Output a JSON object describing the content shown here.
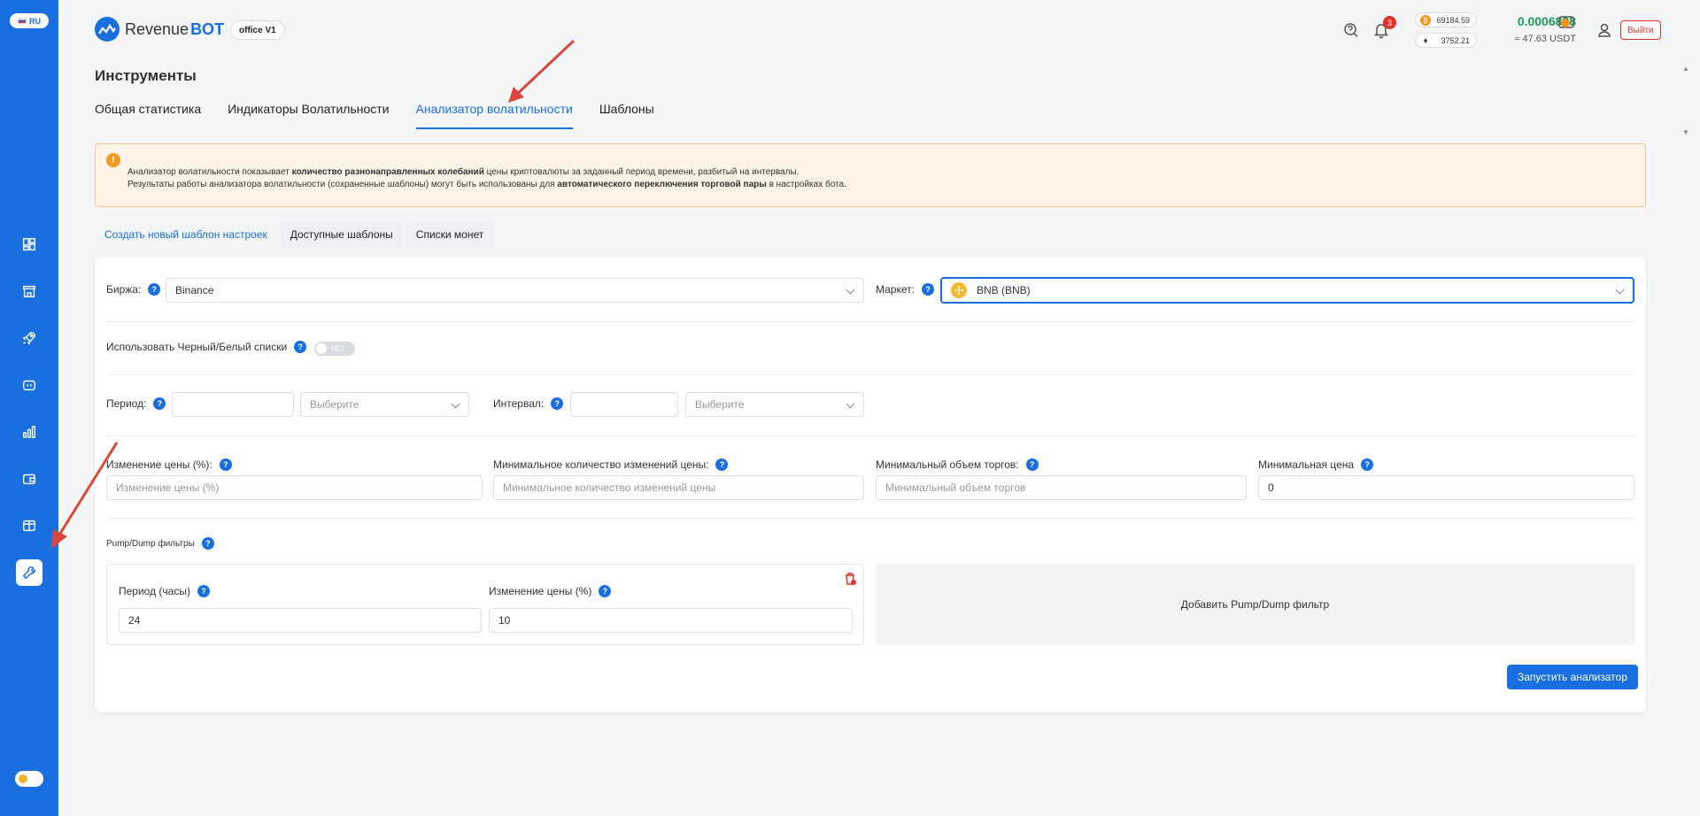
{
  "sidebar": {
    "lang": "RU",
    "icons": [
      "dashboard-icon",
      "store-icon",
      "rocket-icon",
      "robot-icon",
      "chart-icon",
      "wallet-icon",
      "book-icon",
      "wrench-icon"
    ]
  },
  "header": {
    "logo_part1": "Revenue",
    "logo_part2": "BOT",
    "office": "office V1",
    "notifications": "3",
    "btc_price": "69184.59",
    "eth_price": "3752.21",
    "balance": "0.0006888",
    "balance_usdt": "≈ 47.63 USDT",
    "logout": "Выйти"
  },
  "page": {
    "title": "Инструменты",
    "tabs": [
      "Общая статистика",
      "Индикаторы Волатильности",
      "Анализатор волатильности",
      "Шаблоны"
    ],
    "active_tab": "Анализатор волатильности"
  },
  "alert": {
    "line1_a": "Анализатор волатильности показывает ",
    "line1_b": "количество разнонаправленных колебаний",
    "line1_c": " цены криптовалюты за заданный период времени, разбитый на интервалы.",
    "line2_a": "Результаты работы анализатора волатильности (сохраненные шаблоны) могут быть использованы для ",
    "line2_b": "автоматического переключения торговой пары",
    "line2_c": " в настройках бота."
  },
  "subtabs": [
    "Создать новый шаблон настроек",
    "Доступные шаблоны",
    "Списки монет"
  ],
  "form": {
    "exchange_label": "Биржа:",
    "exchange_value": "Binance",
    "market_label": "Маркет:",
    "market_value": "BNB (BNB)",
    "bw_label": "Использовать Черный/Белый списки",
    "bw_toggle": "NO",
    "period_label": "Период:",
    "period_value": "",
    "period_select_placeholder": "Выберите",
    "interval_label": "Интервал:",
    "interval_value": "",
    "interval_select_placeholder": "Выберите",
    "price_change_label": "Изменение цены (%):",
    "price_change_placeholder": "Изменение цены (%)",
    "min_changes_label": "Минимальное количество изменений цены:",
    "min_changes_placeholder": "Минимальное количество изменений цены",
    "min_volume_label": "Минимальный объем торгов:",
    "min_volume_placeholder": "Минимальный объем торгов",
    "min_price_label": "Минимальная цена",
    "min_price_value": "0",
    "pd_title": "Pump/Dump фильтры",
    "pd_period_label": "Период (часы)",
    "pd_period_value": "24",
    "pd_change_label": "Изменение цены (%)",
    "pd_change_value": "10",
    "add_filter": "Добавить Pump/Dump фильтр",
    "run_button": "Запустить анализатор"
  },
  "colors": {
    "accent": "#1a6fe0",
    "balance": "#1d9a57",
    "danger": "#e0332b",
    "alert_bg": "#fdf3e6"
  }
}
